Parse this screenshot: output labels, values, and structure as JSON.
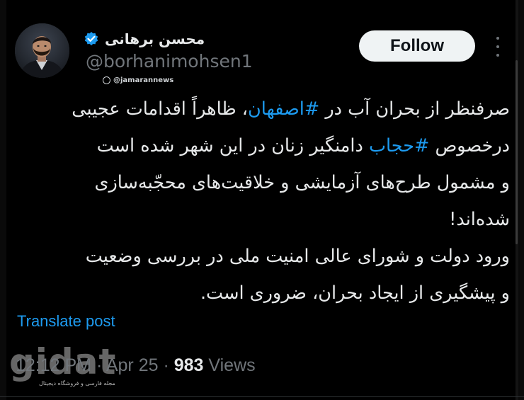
{
  "author": {
    "display_name": "محسن برهانی",
    "handle": "@borhanimohsen1",
    "verified": true
  },
  "watermark_top": "@jamarannews",
  "follow_button_label": "Follow",
  "tweet": {
    "lines": [
      [
        {
          "t": "صرفنظر از بحران آب در ",
          "h": false
        },
        {
          "t": "#اصفهان",
          "h": true
        },
        {
          "t": "، ظاهراً اقدامات عجیبی",
          "h": false
        }
      ],
      [
        {
          "t": "درخصوص ",
          "h": false
        },
        {
          "t": "#حجاب",
          "h": true
        },
        {
          "t": " دامنگیر زنان در این شهر شده است",
          "h": false
        }
      ],
      [
        {
          "t": "و مشمول طرح‌های آزمایشی و خلاقیت‌های محجّبه‌سازی",
          "h": false
        }
      ],
      [
        {
          "t": "شده‌اند!",
          "h": false
        }
      ],
      [
        {
          "t": "ورود دولت و شورای عالی امنیت ملی در بررسی وضعیت",
          "h": false
        }
      ],
      [
        {
          "t": "و پیشگیری از ایجاد بحران، ضروری است.",
          "h": false
        }
      ]
    ]
  },
  "translate_label": "Translate post",
  "meta": {
    "time_date": "12:12 PM · Apr 25 · ",
    "views_count": "983",
    "views_label": " Views"
  },
  "site_watermark": {
    "logo_text": "gidat",
    "tagline": "مجله فارسی و فروشگاه دیجیتال"
  },
  "colors": {
    "background": "#000000",
    "text": "#e7e9ea",
    "secondary": "#71767b",
    "accent": "#1d9bf0",
    "follow_bg": "#eff3f4"
  }
}
